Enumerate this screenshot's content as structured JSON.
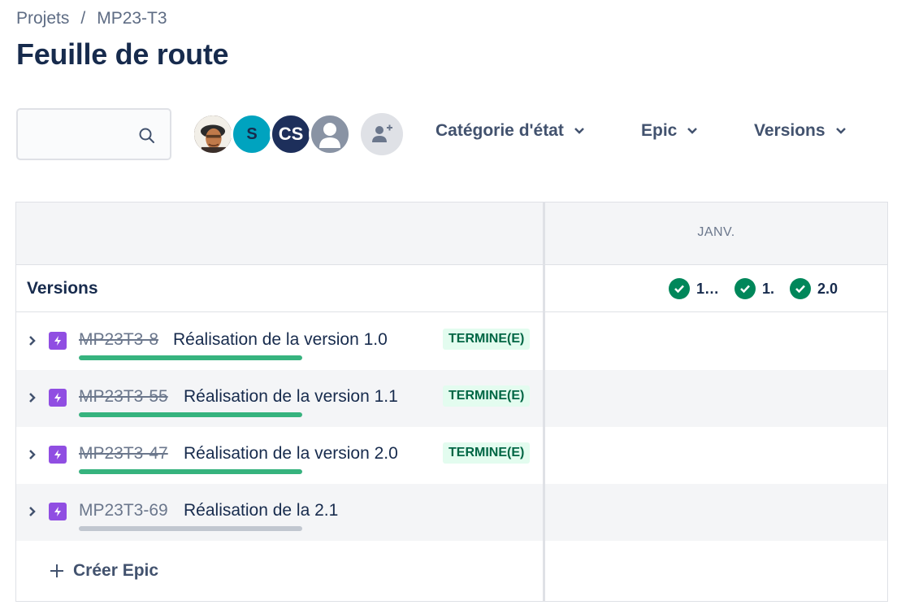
{
  "breadcrumb": {
    "items": [
      "Projets",
      "MP23-T3"
    ],
    "separator": "/"
  },
  "page_title": "Feuille de route",
  "search": {
    "value": "",
    "placeholder": ""
  },
  "avatars": [
    {
      "initials": "",
      "icon": "user-photo-icon"
    },
    {
      "initials": "S",
      "color": "#00a3bf"
    },
    {
      "initials": "CS",
      "color": "#1d2f5b"
    },
    {
      "initials": "",
      "icon": "default-person-icon",
      "color": "#8993a4"
    }
  ],
  "filters": {
    "status_category": "Catégorie d'état",
    "epic": "Epic",
    "versions": "Versions"
  },
  "timeline": {
    "month": "JANV."
  },
  "versions_row": {
    "label": "Versions",
    "markers": [
      {
        "label": "1…",
        "status": "released"
      },
      {
        "label": "1.",
        "status": "released"
      },
      {
        "label": "2.0",
        "status": "released"
      }
    ]
  },
  "epics": [
    {
      "key": "MP23T3-8",
      "summary": "Réalisation de la version 1.0",
      "status": "TERMINE(E)",
      "done": true,
      "progress": 1.0
    },
    {
      "key": "MP23T3-55",
      "summary": "Réalisation de la version 1.1",
      "status": "TERMINE(E)",
      "done": true,
      "progress": 1.0
    },
    {
      "key": "MP23T3-47",
      "summary": "Réalisation de la version 2.0",
      "status": "TERMINE(E)",
      "done": true,
      "progress": 1.0
    },
    {
      "key": "MP23T3-69",
      "summary": "Réalisation de la 2.1",
      "status": "",
      "done": false,
      "progress": 0.0
    }
  ],
  "create_epic_label": "Créer Epic",
  "colors": {
    "done": "#36b37e",
    "epic": "#904ee2",
    "released": "#00875a",
    "status_bg": "#e3fcef"
  }
}
